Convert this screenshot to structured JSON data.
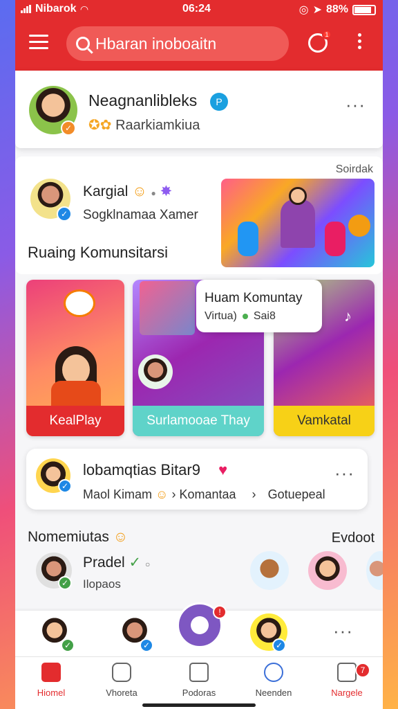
{
  "status": {
    "carrier": "Nibarok",
    "time": "06:24",
    "battery": "88%"
  },
  "topbar": {
    "search_placeholder": "Hbaran inoboaitn",
    "notif_count": "1"
  },
  "profile": {
    "name": "Neagnanlibleks",
    "sub": "Raarkiamkiua",
    "verify": "P"
  },
  "section": {
    "search_label": "Soirdak",
    "kargial_name": "Kargial",
    "kargial_sub": "Sogklnamaa Xamer",
    "title": "Ruaing Komunsitarsi"
  },
  "tiles": [
    {
      "label": "KealPlay",
      "color": "#e32c2e"
    },
    {
      "label": "Surlamooae Thay",
      "color": "#5fd3c9"
    },
    {
      "label": "Vamkatal",
      "color": "#f7d117"
    }
  ],
  "popup": {
    "title": "Huam Komuntay",
    "sub1": "Virtua)",
    "sub2": "Sai8"
  },
  "activity": {
    "title": "lobamqtias Bitar9",
    "sub1": "Maol Kimam",
    "sub2": "Komantaa",
    "sub3": "Gotuepeal"
  },
  "members": {
    "title": "Nomemiutas",
    "explore": "Evdoot",
    "friend_name": "Pradel",
    "friend_sub": "Ilopaos"
  },
  "tabs": [
    {
      "label": "Hiomel",
      "icon": "home-icon"
    },
    {
      "label": "Vhoreta",
      "icon": "explore-icon"
    },
    {
      "label": "Podoras",
      "icon": "bookmark-icon"
    },
    {
      "label": "Neenden",
      "icon": "people-icon"
    },
    {
      "label": "Nargele",
      "icon": "chat-icon",
      "badge": "7"
    }
  ],
  "colors": {
    "primary": "#e32c2e"
  }
}
